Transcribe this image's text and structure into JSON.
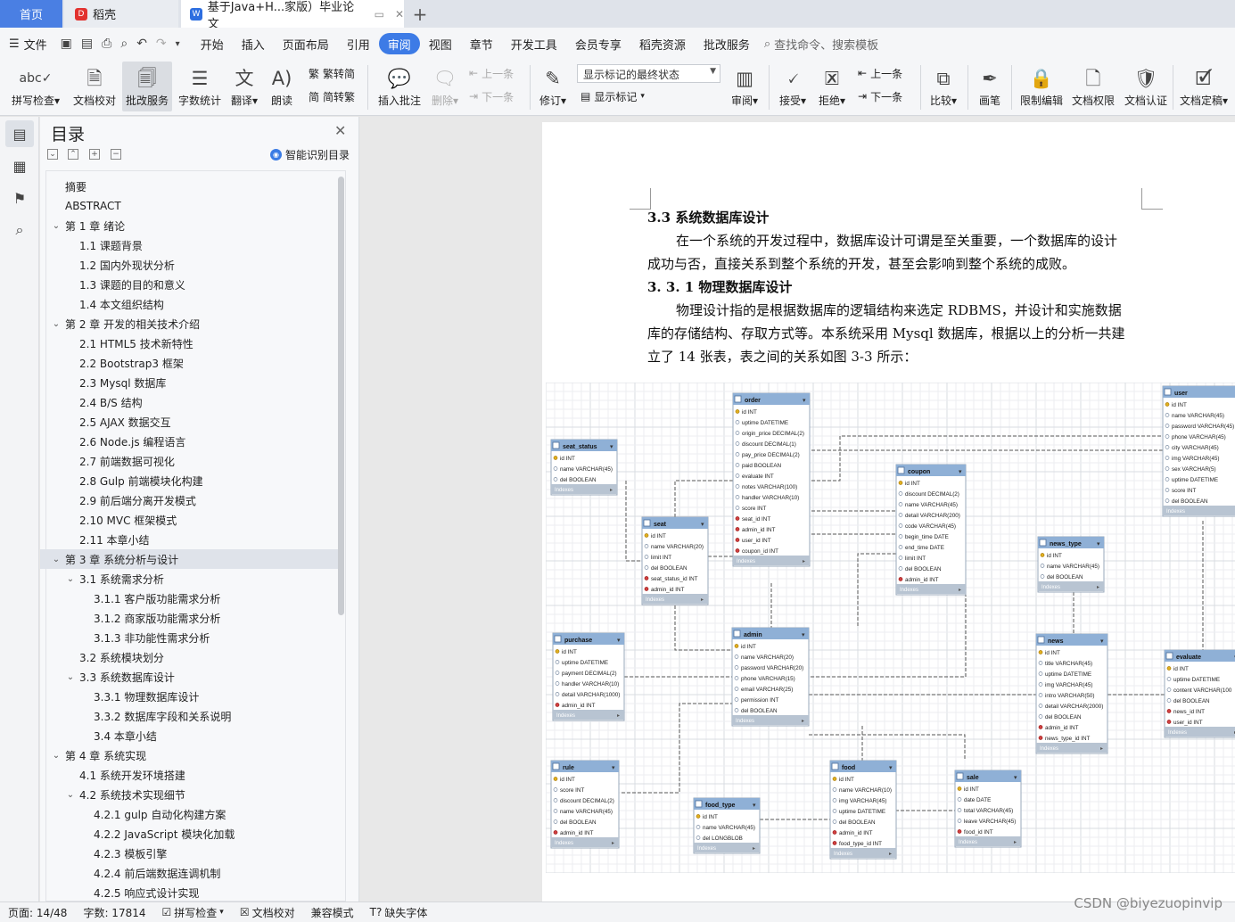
{
  "tabs": {
    "home": "首页",
    "daoke": "稻壳",
    "doc": "基于Java+H...家版）毕业论文",
    "add": "+"
  },
  "menu": [
    "文件",
    "开始",
    "插入",
    "页面布局",
    "引用",
    "审阅",
    "视图",
    "章节",
    "开发工具",
    "会员专享",
    "稻壳资源",
    "批改服务"
  ],
  "menu_active": "审阅",
  "search_cmd": "查找命令、搜索模板",
  "ribbon": {
    "spellcheck": "拼写检查",
    "doc_check": "文档校对",
    "correct_service": "批改服务",
    "word_count": "字数统计",
    "translate": "翻译",
    "read_aloud": "朗读",
    "trad": "繁转简",
    "simp": "简转繁",
    "insert_comment": "插入批注",
    "delete": "删除",
    "prev": "上一条",
    "next": "下一条",
    "revise": "修订",
    "markup_state": "显示标记的最终状态",
    "show_markup": "显示标记",
    "review": "审阅",
    "accept": "接受",
    "reject": "拒绝",
    "prev2": "上一条",
    "next2": "下一条",
    "compare": "比较",
    "pen": "画笔",
    "restrict_edit": "限制编辑",
    "doc_perm": "文档权限",
    "doc_auth": "文档认证",
    "doc_finalize": "文档定稿"
  },
  "toc": {
    "title": "目录",
    "smart": "智能识别目录",
    "items": [
      {
        "text": "摘要",
        "level": 0,
        "caret": ""
      },
      {
        "text": "ABSTRACT",
        "level": 0,
        "caret": ""
      },
      {
        "text": "第 1 章  绪论",
        "level": 0,
        "caret": "v"
      },
      {
        "text": "1.1  课题背景",
        "level": 1,
        "caret": ""
      },
      {
        "text": "1.2  国内外现状分析",
        "level": 1,
        "caret": ""
      },
      {
        "text": "1.3  课题的目的和意义",
        "level": 1,
        "caret": ""
      },
      {
        "text": "1.4  本文组织结构",
        "level": 1,
        "caret": ""
      },
      {
        "text": "第 2 章  开发的相关技术介绍",
        "level": 0,
        "caret": "v"
      },
      {
        "text": "2.1 HTML5 技术新特性",
        "level": 1,
        "caret": ""
      },
      {
        "text": "2.2 Bootstrap3 框架",
        "level": 1,
        "caret": ""
      },
      {
        "text": "2.3 Mysql 数据库",
        "level": 1,
        "caret": ""
      },
      {
        "text": "2.4 B/S 结构",
        "level": 1,
        "caret": ""
      },
      {
        "text": "2.5 AJAX 数据交互",
        "level": 1,
        "caret": ""
      },
      {
        "text": "2.6 Node.js 编程语言",
        "level": 1,
        "caret": ""
      },
      {
        "text": "2.7 前端数据可视化",
        "level": 1,
        "caret": ""
      },
      {
        "text": "2.8 Gulp 前端模块化构建",
        "level": 1,
        "caret": ""
      },
      {
        "text": "2.9 前后端分离开发模式",
        "level": 1,
        "caret": ""
      },
      {
        "text": "2.10 MVC 框架模式",
        "level": 1,
        "caret": ""
      },
      {
        "text": "2.11  本章小结",
        "level": 1,
        "caret": ""
      },
      {
        "text": "第 3 章  系统分析与设计",
        "level": 0,
        "caret": "v",
        "selected": true
      },
      {
        "text": "3.1  系统需求分析",
        "level": 1,
        "caret": "v"
      },
      {
        "text": "3.1.1  客户版功能需求分析",
        "level": 2,
        "caret": ""
      },
      {
        "text": "3.1.2  商家版功能需求分析",
        "level": 2,
        "caret": ""
      },
      {
        "text": "3.1.3  非功能性需求分析",
        "level": 2,
        "caret": ""
      },
      {
        "text": "3.2  系统模块划分",
        "level": 1,
        "caret": ""
      },
      {
        "text": "3.3  系统数据库设计",
        "level": 1,
        "caret": "v"
      },
      {
        "text": "3.3.1 物理数据库设计",
        "level": 2,
        "caret": ""
      },
      {
        "text": "3.3.2  数据库字段和关系说明",
        "level": 2,
        "caret": ""
      },
      {
        "text": "3.4  本章小结",
        "level": 2,
        "caret": ""
      },
      {
        "text": "第 4 章  系统实现",
        "level": 0,
        "caret": "v"
      },
      {
        "text": "4.1  系统开发环境搭建",
        "level": 1,
        "caret": ""
      },
      {
        "text": "4.2  系统技术实现细节",
        "level": 1,
        "caret": "v"
      },
      {
        "text": "4.2.1 gulp 自动化构建方案",
        "level": 2,
        "caret": ""
      },
      {
        "text": "4.2.2 JavaScript 模块化加载",
        "level": 2,
        "caret": ""
      },
      {
        "text": "4.2.3  模板引擎",
        "level": 2,
        "caret": ""
      },
      {
        "text": "4.2.4  前后端数据连调机制",
        "level": 2,
        "caret": ""
      },
      {
        "text": "4.2.5  响应式设计实现",
        "level": 2,
        "caret": ""
      }
    ]
  },
  "doc": {
    "h33": "3.3  系统数据库设计",
    "p1a": "在一个系统的开发过程中，数据库设计可谓是至关重要，一个数据库的设计",
    "p1b": "成功与否，直接关系到整个系统的开发，甚至会影响到整个系统的成败。",
    "h331": "3. 3. 1 物理数据库设计",
    "p2a": "物理设计指的是根据数据库的逻辑结构来选定 RDBMS，并设计和实施数据",
    "p2b": "库的存储结构、存取方式等。本系统采用 Mysql 数据库，根据以上的分析一共建",
    "p2c": "立了 14 张表，表之间的关系如图 3-3 所示："
  },
  "er_tables": [
    {
      "name": "seat_status",
      "fields": [
        "id INT",
        "name VARCHAR(45)",
        "del BOOLEAN"
      ]
    },
    {
      "name": "order",
      "fields": [
        "id INT",
        "uptime DATETIME",
        "origin_price DECIMAL(2)",
        "discount DECIMAL(1)",
        "pay_price DECIMAL(2)",
        "paid BOOLEAN",
        "evaluate INT",
        "notes VARCHAR(100)",
        "handler VARCHAR(10)",
        "score INT",
        "seat_id INT",
        "admin_id INT",
        "user_id INT",
        "coupon_id INT"
      ]
    },
    {
      "name": "user",
      "fields": [
        "id INT",
        "name VARCHAR(45)",
        "password VARCHAR(45)",
        "phone VARCHAR(45)",
        "city VARCHAR(45)",
        "img VARCHAR(45)",
        "sex VARCHAR(5)",
        "uptime DATETIME",
        "score INT",
        "del BOOLEAN"
      ]
    },
    {
      "name": "coupon",
      "fields": [
        "id INT",
        "discount DECIMAL(2)",
        "name VARCHAR(45)",
        "detail VARCHAR(200)",
        "code VARCHAR(45)",
        "begin_time DATE",
        "end_time DATE",
        "limit INT",
        "del BOOLEAN",
        "admin_id INT"
      ]
    },
    {
      "name": "seat",
      "fields": [
        "id INT",
        "name VARCHAR(20)",
        "limit INT",
        "del BOOLEAN",
        "seat_status_id INT",
        "admin_id INT"
      ]
    },
    {
      "name": "news_type",
      "fields": [
        "id INT",
        "name VARCHAR(45)",
        "del BOOLEAN"
      ]
    },
    {
      "name": "purchase",
      "fields": [
        "id INT",
        "uptime DATETIME",
        "payment DECIMAL(2)",
        "handler VARCHAR(10)",
        "detail VARCHAR(1000)",
        "admin_id INT"
      ]
    },
    {
      "name": "admin",
      "fields": [
        "id INT",
        "name VARCHAR(20)",
        "password VARCHAR(20)",
        "phone VARCHAR(15)",
        "email VARCHAR(25)",
        "permission INT",
        "del BOOLEAN"
      ]
    },
    {
      "name": "news",
      "fields": [
        "id INT",
        "title VARCHAR(45)",
        "uptime DATETIME",
        "img VARCHAR(45)",
        "intro VARCHAR(50)",
        "detail VARCHAR(2000)",
        "del BOOLEAN",
        "admin_id INT",
        "news_type_id INT"
      ]
    },
    {
      "name": "evaluate",
      "fields": [
        "id INT",
        "uptime DATETIME",
        "content VARCHAR(100",
        "del BOOLEAN",
        "news_id INT",
        "user_id INT"
      ]
    },
    {
      "name": "rule",
      "fields": [
        "id INT",
        "score INT",
        "discount DECIMAL(2)",
        "name VARCHAR(45)",
        "del BOOLEAN",
        "admin_id INT"
      ]
    },
    {
      "name": "food_type",
      "fields": [
        "id INT",
        "name VARCHAR(45)",
        "del LONGBLOB"
      ]
    },
    {
      "name": "food",
      "fields": [
        "id INT",
        "name VARCHAR(10)",
        "img VARCHAR(45)",
        "uptime DATETIME",
        "del BOOLEAN",
        "admin_id INT",
        "food_type_id INT"
      ]
    },
    {
      "name": "sale",
      "fields": [
        "id INT",
        "date DATE",
        "total VARCHAR(45)",
        "leave VARCHAR(45)",
        "food_id INT"
      ]
    }
  ],
  "er_indexes_label": "Indexes",
  "status": {
    "page": "页面: 14/48",
    "words": "字数: 17814",
    "spell": "拼写检查",
    "proof": "文档校对",
    "compat": "兼容模式",
    "missing_font": "缺失字体"
  },
  "watermark": "CSDN @biyezuopinvip"
}
